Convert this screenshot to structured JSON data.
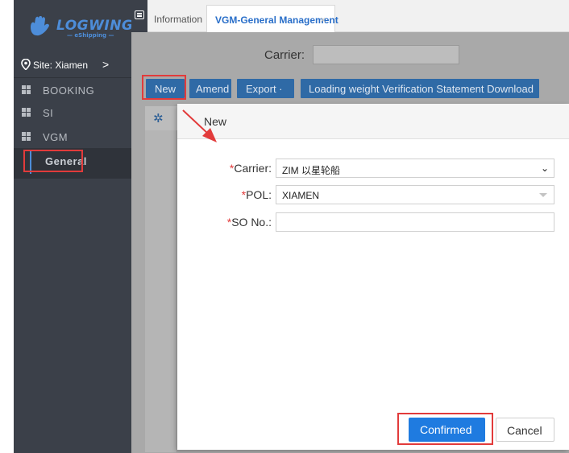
{
  "brand": {
    "name": "LOGWING",
    "tagline": "— eShipping —",
    "accent_color": "#4d8dd9"
  },
  "sidebar": {
    "site_label": "Site: Xiamen",
    "site_chevron": ">",
    "items": [
      {
        "label": "BOOKING",
        "icon": "grid-icon"
      },
      {
        "label": "SI",
        "icon": "grid-icon"
      },
      {
        "label": "VGM",
        "icon": "grid-icon"
      }
    ],
    "sub_item": {
      "label": "General"
    }
  },
  "tabs": {
    "info": "Information",
    "active": "VGM-General Management",
    "close_glyph": "×"
  },
  "filter": {
    "carrier_label": "Carrier:",
    "carrier_value": ""
  },
  "toolbar": {
    "new_label": "New",
    "amend_label": "Amend",
    "export_label": "Export ·",
    "download_label": "Loading weight Verification Statement Download",
    "button_color": "#2f6aa6"
  },
  "modal": {
    "title": "New",
    "fields": {
      "carrier": {
        "required": "*",
        "label": "Carrier:",
        "value": "ZIM 以星轮船",
        "caret": "⌄"
      },
      "pol": {
        "required": "*",
        "label": "POL:",
        "value": "XIAMEN"
      },
      "so": {
        "required": "*",
        "label": "SO No.:",
        "value": ""
      }
    },
    "confirm_label": "Confirmed",
    "cancel_label": "Cancel",
    "confirm_color": "#1f7be0"
  },
  "annotations": {
    "highlight_color": "#e23b3b"
  }
}
